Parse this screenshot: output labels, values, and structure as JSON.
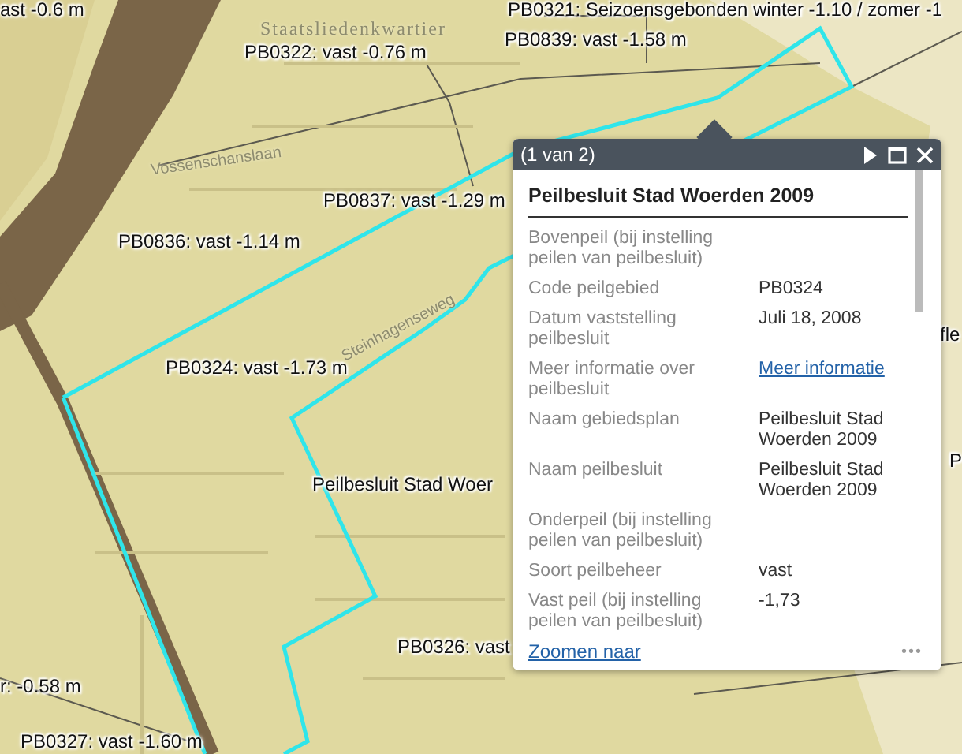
{
  "map": {
    "labels": [
      {
        "text": "ast -0.6 m"
      },
      {
        "text": "PB0321: Seizoensgebonden winter -1.10 / zomer -1"
      },
      {
        "text": "PB0322: vast -0.76 m"
      },
      {
        "text": "PB0839: vast -1.58 m"
      },
      {
        "text": "PB0837: vast -1.29 m"
      },
      {
        "text": "PB0836: vast -1.14 m"
      },
      {
        "text": "PB0324: vast -1.73 m"
      },
      {
        "text": "Peilbesluit Stad Woer"
      },
      {
        "text": "PB0326: vast"
      },
      {
        "text": "r: -0.58 m"
      },
      {
        "text": "PB0327: vast -1.60 m"
      },
      {
        "text": "fle"
      },
      {
        "text": "P"
      }
    ],
    "street_labels": [
      {
        "text": "Staatsliedenkwartier",
        "kind": "district"
      },
      {
        "text": "Vossenschanslaan",
        "kind": "street"
      },
      {
        "text": "Steinhagenseweg",
        "kind": "street"
      }
    ]
  },
  "popup": {
    "pager": "(1 van 2)",
    "title": "Peilbesluit Stad Woerden 2009",
    "fields": [
      {
        "label": "Bovenpeil (bij instelling peilen van peilbesluit)"
      },
      {
        "label": "Code peilgebied",
        "value": "PB0324",
        "kind": "text"
      },
      {
        "label": "Datum vaststelling peilbesluit",
        "value": "Juli 18, 2008",
        "kind": "text"
      },
      {
        "label": "Meer informatie over peilbesluit",
        "value": "Meer informatie",
        "kind": "link"
      },
      {
        "label": "Naam gebiedsplan",
        "value": "Peilbesluit Stad Woerden 2009",
        "kind": "text"
      },
      {
        "label": "Naam peilbesluit",
        "value": "Peilbesluit Stad Woerden 2009",
        "kind": "text"
      },
      {
        "label": "Onderpeil (bij instelling peilen van peilbesluit)"
      },
      {
        "label": "Soort peilbeheer",
        "value": "vast",
        "kind": "text"
      },
      {
        "label": "Vast peil (bij instelling peilen van peilbesluit)",
        "value": "-1,73",
        "kind": "text"
      }
    ],
    "footer_link": "Zoomen naar",
    "more": "•••"
  }
}
